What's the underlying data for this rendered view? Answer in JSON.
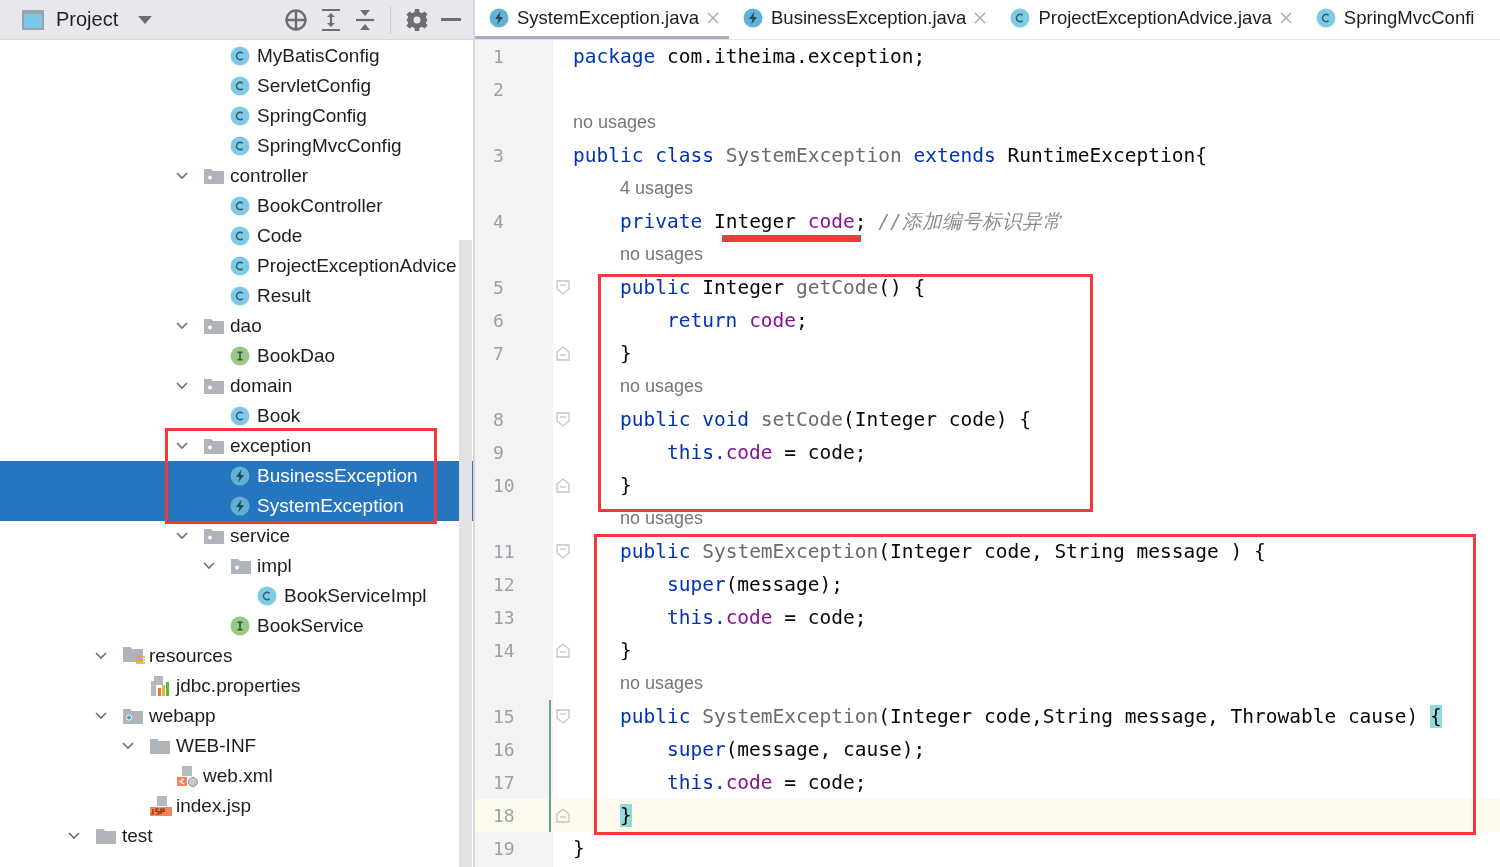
{
  "project_panel": {
    "title": "Project",
    "tree": [
      {
        "children": [
          {
            "children": [
              {
                "children": [
                  {
                    "children": [
                      {
                        "children": [
                          {
                            "label": "MyBatisConfig",
                            "kind": "class",
                            "selected": false
                          },
                          {
                            "label": "ServletConfig",
                            "kind": "class",
                            "selected": false
                          },
                          {
                            "label": "SpringConfig",
                            "kind": "class",
                            "selected": false
                          },
                          {
                            "label": "SpringMvcConfig",
                            "kind": "class",
                            "selected": false
                          }
                        ]
                      },
                      {
                        "label": "controller",
                        "kind": "folder",
                        "expanded": true,
                        "selected": false,
                        "children": [
                          {
                            "label": "BookController",
                            "kind": "class",
                            "selected": false
                          },
                          {
                            "label": "Code",
                            "kind": "class",
                            "selected": false
                          },
                          {
                            "label": "ProjectExceptionAdvice",
                            "kind": "class",
                            "selected": false
                          },
                          {
                            "label": "Result",
                            "kind": "class",
                            "selected": false
                          }
                        ]
                      },
                      {
                        "label": "dao",
                        "kind": "folder",
                        "expanded": true,
                        "selected": false,
                        "children": [
                          {
                            "label": "BookDao",
                            "kind": "interface",
                            "selected": false
                          }
                        ]
                      },
                      {
                        "label": "domain",
                        "kind": "folder",
                        "expanded": true,
                        "selected": false,
                        "children": [
                          {
                            "label": "Book",
                            "kind": "class",
                            "selected": false
                          }
                        ]
                      },
                      {
                        "label": "exception",
                        "kind": "folder",
                        "expanded": true,
                        "selected": false,
                        "children": [
                          {
                            "label": "BusinessException",
                            "kind": "exception",
                            "selected": true
                          },
                          {
                            "label": "SystemException",
                            "kind": "exception",
                            "selected": true
                          }
                        ]
                      },
                      {
                        "label": "service",
                        "kind": "folder",
                        "expanded": true,
                        "selected": false,
                        "children": [
                          {
                            "label": "impl",
                            "kind": "folder",
                            "expanded": true,
                            "selected": false,
                            "children": [
                              {
                                "label": "BookServiceImpl",
                                "kind": "class",
                                "selected": false
                              }
                            ]
                          },
                          {
                            "label": "BookService",
                            "kind": "interface",
                            "selected": false
                          }
                        ]
                      }
                    ]
                  }
                ]
              }
            ]
          },
          {
            "label": "resources",
            "kind": "resources",
            "expanded": true,
            "selected": false,
            "children": [
              {
                "label": "jdbc.properties",
                "kind": "properties",
                "selected": false
              }
            ]
          },
          {
            "label": "webapp",
            "kind": "webfolder",
            "expanded": true,
            "selected": false,
            "children": [
              {
                "label": "WEB-INF",
                "kind": "plainfolder",
                "expanded": true,
                "selected": false,
                "children": [
                  {
                    "label": "web.xml",
                    "kind": "xml",
                    "selected": false
                  }
                ]
              },
              {
                "label": "index.jsp",
                "kind": "jsp",
                "selected": false
              }
            ]
          }
        ]
      },
      {
        "label": "test",
        "kind": "plainfolder",
        "expanded": true,
        "selected": false
      }
    ]
  },
  "editor": {
    "tabs": [
      {
        "label": "SystemException.java",
        "kind": "exception",
        "selected": true,
        "closable": true
      },
      {
        "label": "BusinessException.java",
        "kind": "exception",
        "selected": false,
        "closable": true
      },
      {
        "label": "ProjectExceptionAdvice.java",
        "kind": "class",
        "selected": false,
        "closable": true
      },
      {
        "label": "SpringMvcConfi",
        "kind": "class",
        "selected": false,
        "closable": false
      }
    ],
    "lines": [
      {
        "number": "1",
        "tokens": [
          {
            "kind": "kw",
            "text": "package"
          },
          {
            "kind": "plain",
            "text": " com.itheima.exception;"
          }
        ]
      },
      {
        "number": "2"
      },
      {
        "number": "3",
        "hint": "no usages",
        "tokens": [
          {
            "kind": "kw",
            "text": "public class "
          },
          {
            "kind": "grey",
            "text": "SystemException"
          },
          {
            "kind": "kw",
            "text": " extends "
          },
          {
            "kind": "plain",
            "text": "RuntimeException{"
          }
        ]
      },
      {
        "number": "4",
        "hint": "4 usages",
        "tokens": [
          {
            "kind": "kw",
            "text": "    private"
          },
          {
            "kind": "plain",
            "text": " Integer "
          },
          {
            "kind": "field",
            "text": "code"
          },
          {
            "kind": "plain",
            "text": "; "
          },
          {
            "kind": "comment",
            "text": "//添加编号标识异常"
          }
        ]
      },
      {
        "number": "5",
        "hint": "no usages",
        "fold_open": true,
        "tokens": [
          {
            "kind": "kw",
            "text": "    public"
          },
          {
            "kind": "plain",
            "text": " Integer "
          },
          {
            "kind": "grey",
            "text": "getCode"
          },
          {
            "kind": "plain",
            "text": "() {"
          }
        ]
      },
      {
        "number": "6",
        "tokens": [
          {
            "kind": "kw",
            "text": "        return"
          },
          {
            "kind": "field",
            "text": " code"
          },
          {
            "kind": "plain",
            "text": ";"
          }
        ]
      },
      {
        "number": "7",
        "fold_close": true,
        "tokens": [
          {
            "kind": "plain",
            "text": "    }"
          }
        ]
      },
      {
        "number": "8",
        "hint": "no usages",
        "fold_open": true,
        "tokens": [
          {
            "kind": "kw",
            "text": "    public void"
          },
          {
            "kind": "grey",
            "text": " setCode"
          },
          {
            "kind": "plain",
            "text": "(Integer code) {"
          }
        ]
      },
      {
        "number": "9",
        "tokens": [
          {
            "kind": "kw",
            "text": "        this."
          },
          {
            "kind": "field",
            "text": "code"
          },
          {
            "kind": "plain",
            "text": " = code;"
          }
        ]
      },
      {
        "number": "10",
        "fold_close": true,
        "tokens": [
          {
            "kind": "plain",
            "text": "    }"
          }
        ]
      },
      {
        "number": "11",
        "hint": "no usages",
        "fold_open": true,
        "tokens": [
          {
            "kind": "kw",
            "text": "    public"
          },
          {
            "kind": "grey",
            "text": " SystemException"
          },
          {
            "kind": "plain",
            "text": "(Integer code, String message ) {"
          }
        ]
      },
      {
        "number": "12",
        "tokens": [
          {
            "kind": "kw",
            "text": "        super"
          },
          {
            "kind": "plain",
            "text": "(message);"
          }
        ]
      },
      {
        "number": "13",
        "tokens": [
          {
            "kind": "kw",
            "text": "        this."
          },
          {
            "kind": "field",
            "text": "code"
          },
          {
            "kind": "plain",
            "text": " = code;"
          }
        ]
      },
      {
        "number": "14",
        "fold_close": true,
        "tokens": [
          {
            "kind": "plain",
            "text": "    }"
          }
        ]
      },
      {
        "number": "15",
        "hint": "no usages",
        "fold_open": true,
        "changed": true,
        "tokens": [
          {
            "kind": "kw",
            "text": "    public"
          },
          {
            "kind": "grey",
            "text": " SystemException"
          },
          {
            "kind": "plain",
            "text": "(Integer code,String message, Throwable cause) "
          },
          {
            "kind": "match",
            "text": "{"
          }
        ]
      },
      {
        "number": "16",
        "changed": true,
        "tokens": [
          {
            "kind": "kw",
            "text": "        super"
          },
          {
            "kind": "plain",
            "text": "(message, cause);"
          }
        ]
      },
      {
        "number": "17",
        "changed": true,
        "tokens": [
          {
            "kind": "kw",
            "text": "        this."
          },
          {
            "kind": "field",
            "text": "code"
          },
          {
            "kind": "plain",
            "text": " = code;"
          }
        ]
      },
      {
        "number": "18",
        "fold_close": true,
        "changed": true,
        "current": true,
        "tokens": [
          {
            "kind": "match",
            "text": "    }"
          }
        ]
      },
      {
        "number": "19",
        "tokens": [
          {
            "kind": "plain",
            "text": "}"
          }
        ]
      }
    ]
  }
}
